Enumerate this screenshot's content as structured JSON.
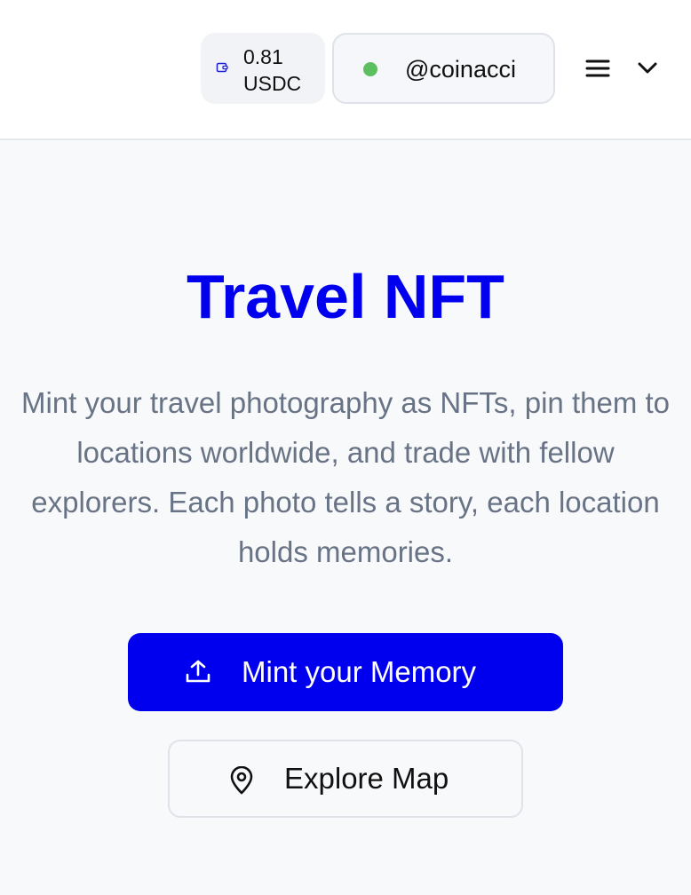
{
  "header": {
    "wallet": {
      "amount": "0.81",
      "currency": "USDC",
      "icon": "wallet-icon"
    },
    "user": {
      "username": "@coinacci",
      "status_color": "#5cbf60"
    },
    "menu_icon": "hamburger-menu-icon",
    "dropdown_icon": "chevron-down-icon"
  },
  "hero": {
    "title": "Travel NFT",
    "description": "Mint your travel photography as NFTs, pin them to locations worldwide, and trade with fellow explorers. Each photo tells a story, each location holds memories."
  },
  "actions": {
    "mint_label": "Mint your Memory",
    "mint_icon": "upload-icon",
    "explore_label": "Explore Map",
    "explore_icon": "map-pin-icon"
  },
  "colors": {
    "accent": "#0000ee",
    "background": "#f8f9fb",
    "muted_text": "#687386"
  }
}
